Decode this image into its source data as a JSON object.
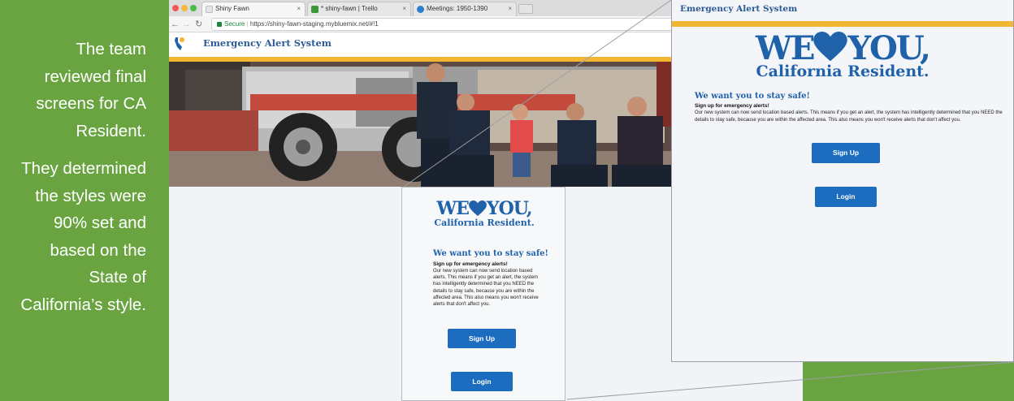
{
  "caption": {
    "paragraph_1": "The team reviewed final screens for CA Resident.",
    "paragraph_2": "They determined the styles were 90% set and based on the State of California’s style."
  },
  "browser": {
    "tabs": [
      {
        "label": "Shiny Fawn",
        "icon_color": "#e6e6e6"
      },
      {
        "label": "* shiny-fawn | Trello",
        "icon_color": "#3a9a3a"
      },
      {
        "label": "Meetings: 1950-1390",
        "icon_color": "#2d7fd0"
      }
    ],
    "secure_label": "Secure",
    "url": "https://shiny-fawn-staging.mybluemix.net/#!1"
  },
  "site": {
    "title": "Emergency Alert System"
  },
  "mockup": {
    "we": "WE",
    "you": "YOU",
    "comma": ",",
    "resident": "California Resident.",
    "stay_safe": "We want you to stay safe!",
    "signup_heading": "Sign up for emergency alerts!",
    "body": "Our new system can now send location based alerts. This means if you get an alert, the system has intelligently determined that you NEED the details to stay safe, because you are within the affected area. This also means you won't receive alerts that don't affect you.",
    "signup_button": "Sign Up",
    "login_button": "Login"
  },
  "colors": {
    "green": "#6aa441",
    "brand_blue": "#1f62aa",
    "button_blue": "#1c6dbf",
    "gold": "#f2b632"
  }
}
